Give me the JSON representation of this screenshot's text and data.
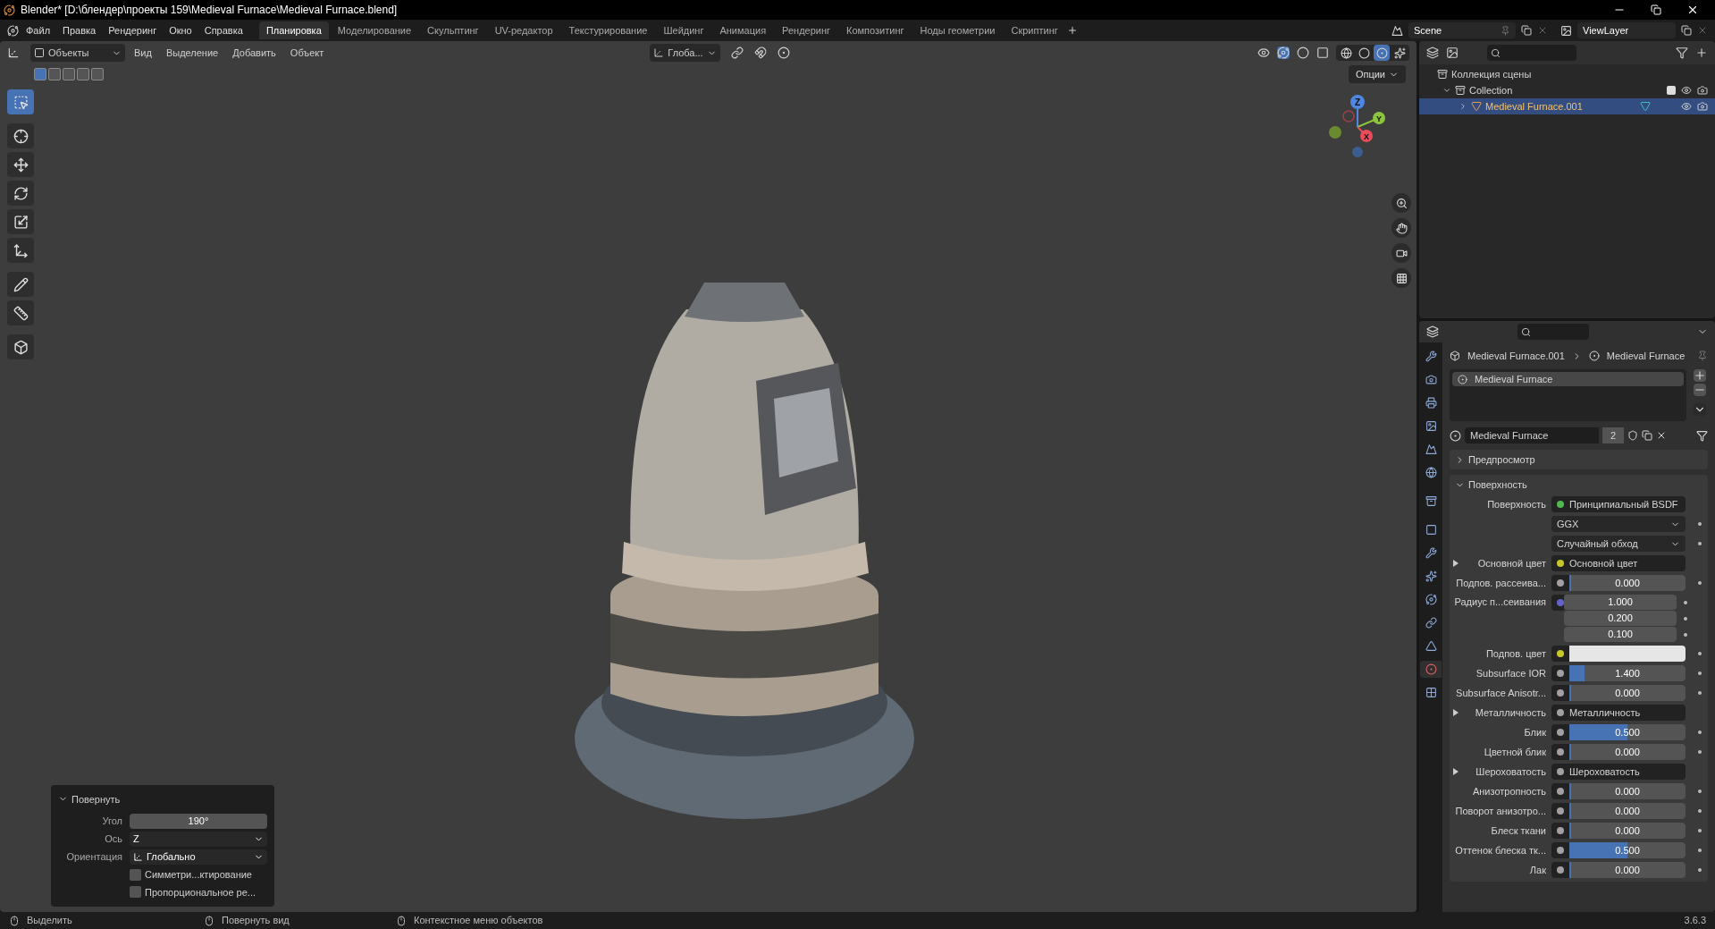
{
  "window": {
    "title": "Blender* [D:\\блендер\\проекты 159\\Medieval Furnace\\Medieval Furnace.blend]"
  },
  "menu": [
    "Файл",
    "Правка",
    "Рендеринг",
    "Окно",
    "Справка"
  ],
  "workspaces": [
    {
      "label": "Планировка",
      "selected": true
    },
    {
      "label": "Моделирование",
      "selected": false
    },
    {
      "label": "Скульптинг",
      "selected": false
    },
    {
      "label": "UV-редактор",
      "selected": false
    },
    {
      "label": "Текстурирование",
      "selected": false
    },
    {
      "label": "Шейдинг",
      "selected": false
    },
    {
      "label": "Анимация",
      "selected": false
    },
    {
      "label": "Рендеринг",
      "selected": false
    },
    {
      "label": "Композитинг",
      "selected": false
    },
    {
      "label": "Ноды геометрии",
      "selected": false
    },
    {
      "label": "Скриптинг",
      "selected": false
    }
  ],
  "scene": {
    "name": "Scene"
  },
  "view_layer": {
    "name": "ViewLayer"
  },
  "viewport": {
    "mode": "Объекты",
    "menus": [
      "Вид",
      "Выделение",
      "Добавить",
      "Объект"
    ],
    "orientation": "Глоба...",
    "options": "Опции",
    "tools": [
      {
        "selected": true
      },
      {
        "selected": false
      },
      {
        "selected": false
      },
      {
        "selected": false
      },
      {
        "selected": false
      },
      {
        "selected": false
      },
      {
        "selected": false
      },
      {
        "selected": false
      },
      {
        "selected": false
      }
    ],
    "select_modes": [
      {
        "selected": true
      },
      {
        "selected": false
      },
      {
        "selected": false
      },
      {
        "selected": false
      },
      {
        "selected": false
      }
    ],
    "shading_modes": [
      {
        "selected": false
      },
      {
        "selected": false
      },
      {
        "selected": true
      },
      {
        "selected": false
      }
    ],
    "gizmo_axes": [
      "Z",
      "Y",
      "X"
    ]
  },
  "operator_panel": {
    "title": "Повернуть",
    "expanded": true,
    "fields": [
      {
        "kind": "number",
        "label": "Угол",
        "value": "190°"
      },
      {
        "kind": "dropdown",
        "label": "Ось",
        "value": "Z"
      },
      {
        "kind": "dropdown",
        "label": "Ориентация",
        "value": "Глобально"
      },
      {
        "kind": "checkbox",
        "label": "Симметри...ктирование",
        "checked": false
      },
      {
        "kind": "checkbox",
        "label": "Пропорциональное ре...",
        "checked": false
      }
    ]
  },
  "outliner": {
    "root": "Коллекция сцены",
    "children": [
      {
        "label": "Collection",
        "expanded": true,
        "selected": false,
        "children": [
          {
            "label": "Medieval Furnace.001",
            "expanded": false,
            "selected": true
          }
        ]
      }
    ]
  },
  "properties": {
    "tabs": [
      {
        "selected": false
      },
      {
        "selected": false
      },
      {
        "selected": false
      },
      {
        "selected": false
      },
      {
        "selected": false
      },
      {
        "selected": false
      },
      {
        "selected": false
      },
      {
        "selected": false
      },
      {
        "selected": false
      },
      {
        "selected": false
      },
      {
        "selected": false
      },
      {
        "selected": false
      },
      {
        "selected": false
      },
      {
        "selected": true
      },
      {
        "selected": false
      }
    ],
    "breadcrumb": [
      "Medieval Furnace.001",
      "Medieval Furnace"
    ],
    "slots": [
      {
        "label": "Medieval Furnace",
        "selected": true
      }
    ],
    "material": {
      "name": "Medieval Furnace",
      "users": "2"
    },
    "panels": [
      {
        "title": "Предпросмотр",
        "expanded": false
      },
      {
        "title": "Поверхность",
        "expanded": true
      }
    ],
    "rows": [
      {
        "kind": "link",
        "label": "Поверхность",
        "color": "#4fb84f",
        "value": "Принципиальный BSDF",
        "expandable": false
      },
      {
        "kind": "dropdown",
        "value": "GGX"
      },
      {
        "kind": "dropdown",
        "value": "Случайный обход"
      },
      {
        "kind": "link",
        "label": "Основной цвет",
        "color": "#c7c729",
        "value": "Основной цвет",
        "expandable": true
      },
      {
        "kind": "value",
        "label": "Подпов. рассеива...",
        "color": "#a1a1a1",
        "value": "0.000",
        "level": 0
      },
      {
        "kind": "vector",
        "label": "Радиус п...сеивания",
        "color": "#6363c7",
        "values": [
          "1.000",
          "0.200",
          "0.100"
        ]
      },
      {
        "kind": "color",
        "label": "Подпов. цвет",
        "color": "#c7c729"
      },
      {
        "kind": "value",
        "label": "Subsurface IOR",
        "color": "#a1a1a1",
        "value": "1.400",
        "level": 0.13
      },
      {
        "kind": "value",
        "label": "Subsurface Anisotr...",
        "color": "#a1a1a1",
        "value": "0.000",
        "level": 0
      },
      {
        "kind": "link",
        "label": "Металличность",
        "color": "#a1a1a1",
        "value": "Металличность",
        "expandable": true
      },
      {
        "kind": "value",
        "label": "Блик",
        "color": "#a1a1a1",
        "value": "0.500",
        "level": 0.5
      },
      {
        "kind": "value",
        "label": "Цветной блик",
        "color": "#a1a1a1",
        "value": "0.000",
        "level": 0
      },
      {
        "kind": "link",
        "label": "Шероховатость",
        "color": "#a1a1a1",
        "value": "Шероховатость",
        "expandable": true
      },
      {
        "kind": "value",
        "label": "Анизотропность",
        "color": "#a1a1a1",
        "value": "0.000",
        "level": 0
      },
      {
        "kind": "value",
        "label": "Поворот анизотро...",
        "color": "#a1a1a1",
        "value": "0.000",
        "level": 0
      },
      {
        "kind": "value",
        "label": "Блеск ткани",
        "color": "#a1a1a1",
        "value": "0.000",
        "level": 0
      },
      {
        "kind": "value",
        "label": "Оттенок блеска тк...",
        "color": "#a1a1a1",
        "value": "0.500",
        "level": 0.5
      },
      {
        "kind": "value",
        "label": "Лак",
        "color": "#a1a1a1",
        "value": "0.000",
        "level": 0
      }
    ]
  },
  "status_bar": {
    "hints": [
      "Выделить",
      "Повернуть вид",
      "Контекстное меню объектов"
    ],
    "version": "3.6.3"
  }
}
